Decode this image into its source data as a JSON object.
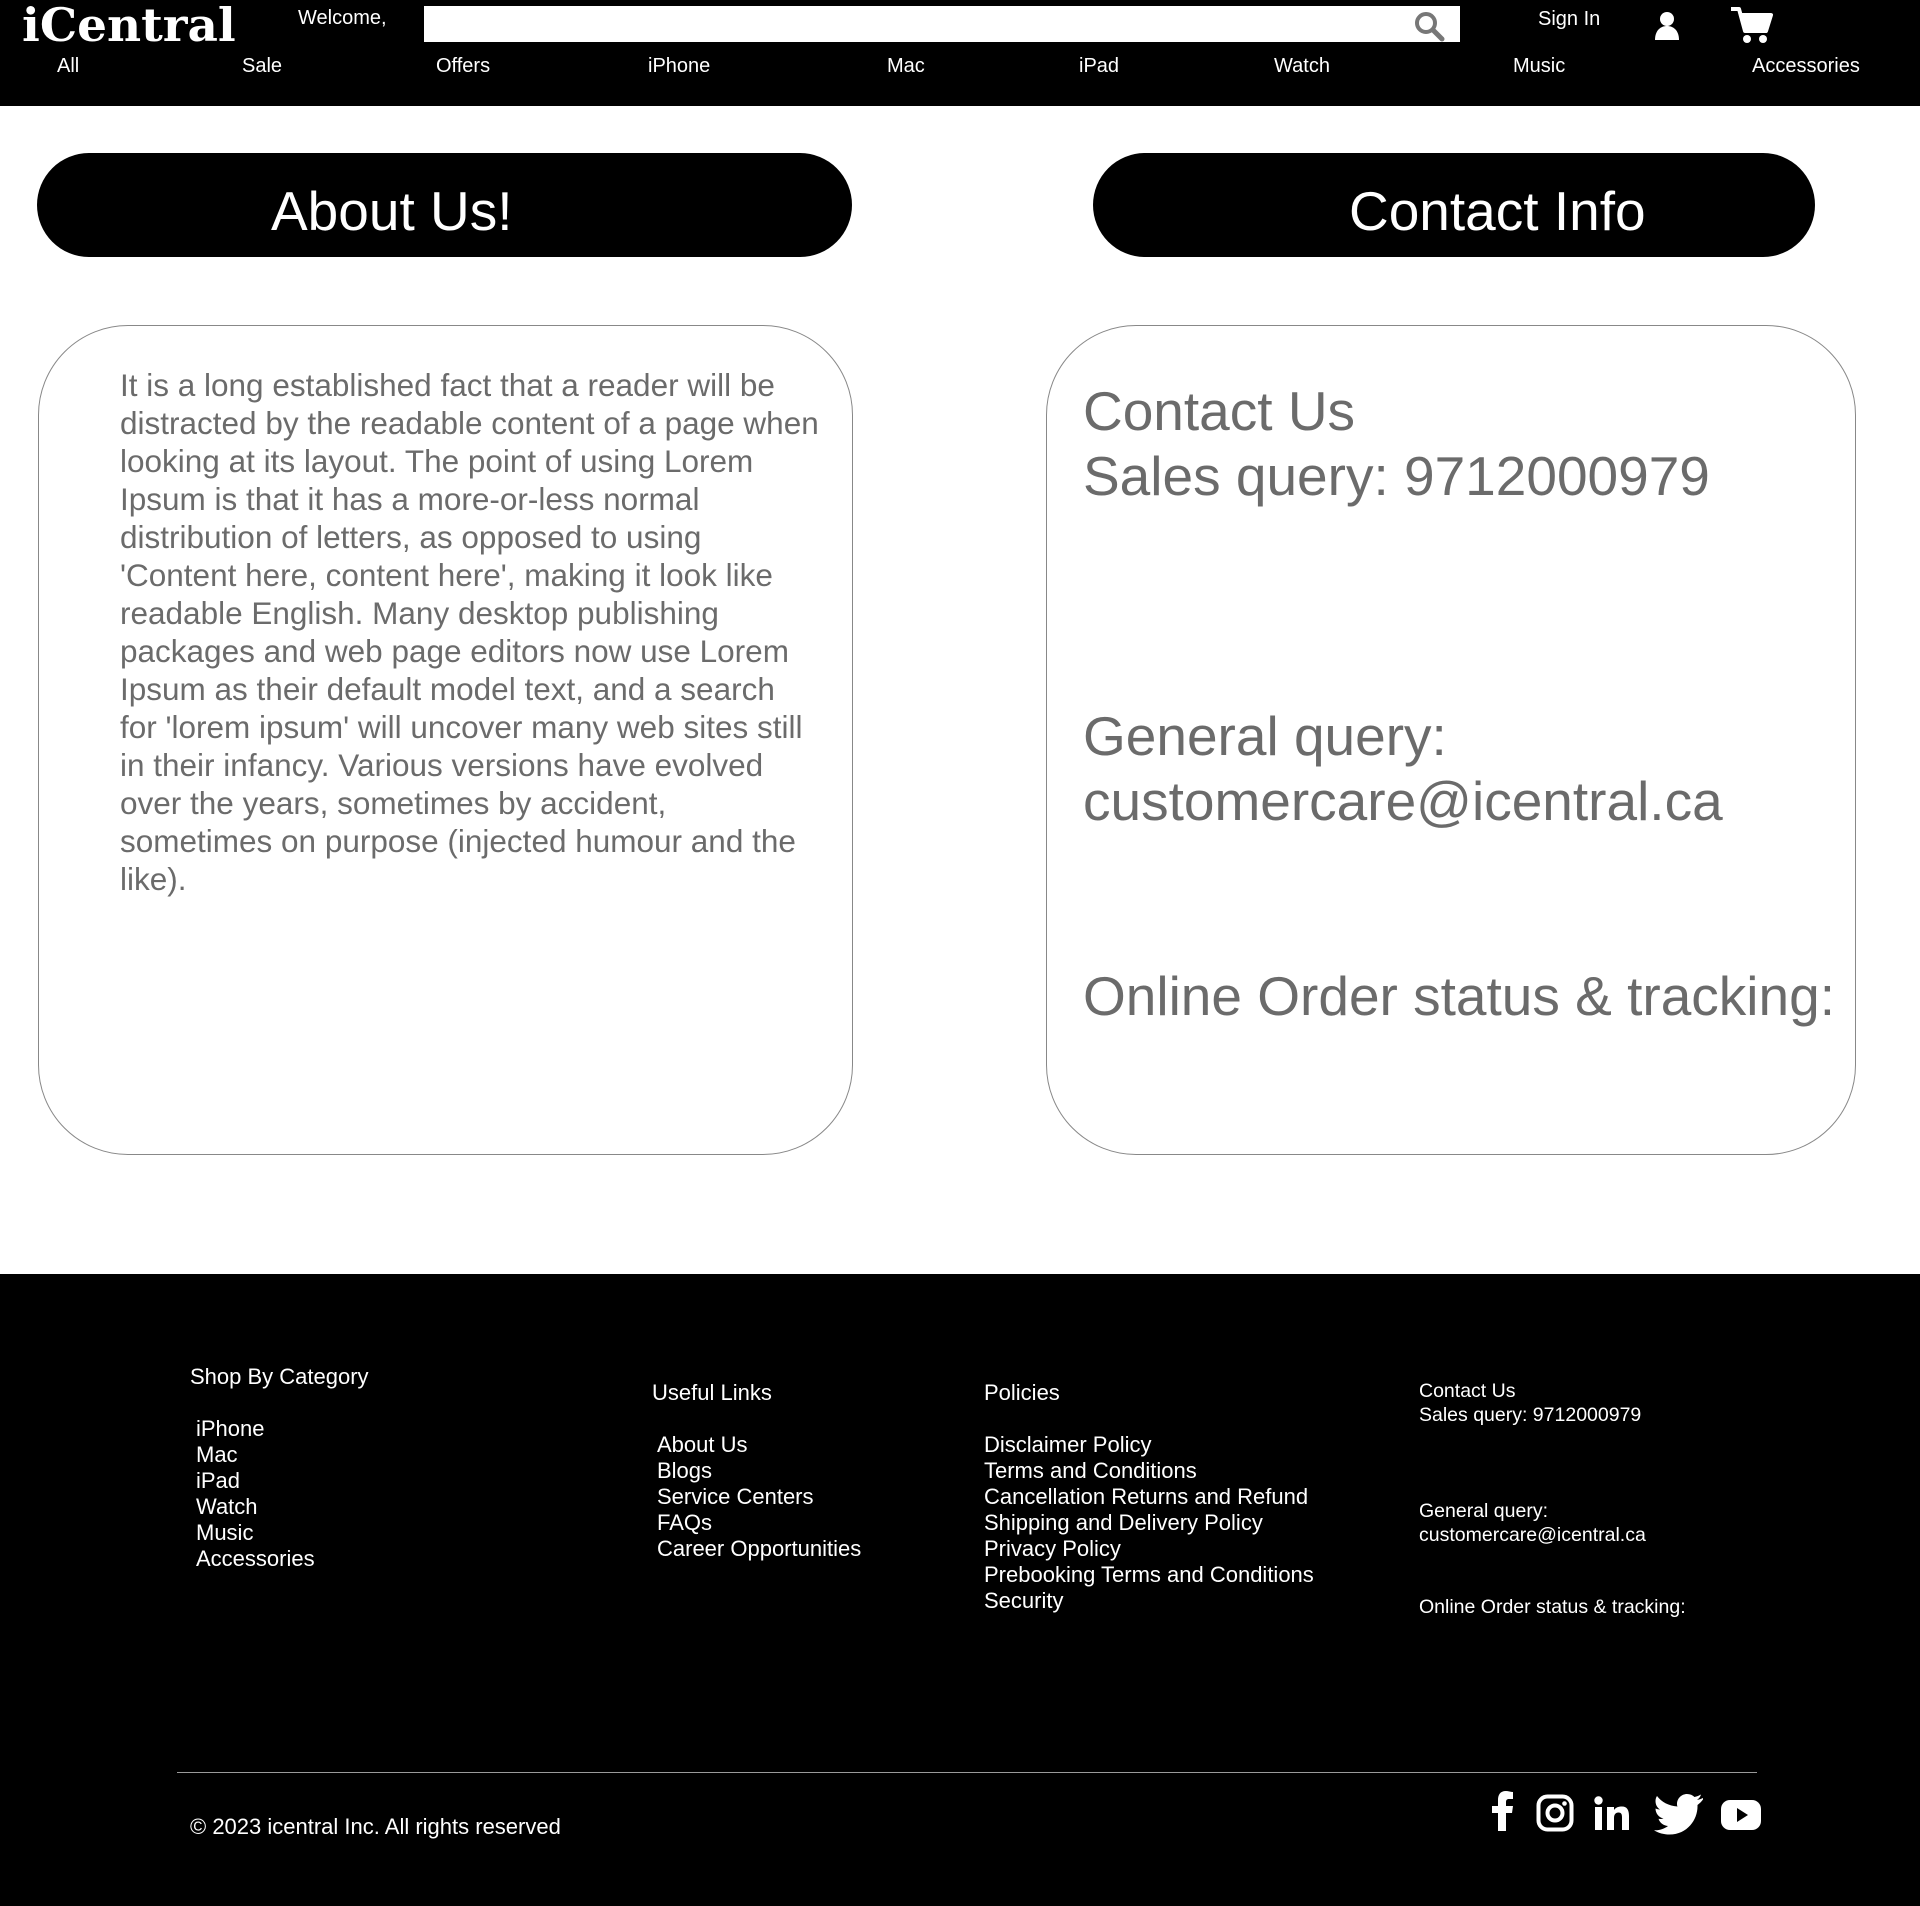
{
  "header": {
    "logo": "iCentral",
    "welcome": "Welcome,",
    "search_placeholder": "",
    "sign_in": "Sign In"
  },
  "nav": [
    "All",
    "Sale",
    "Offers",
    "iPhone",
    "Mac",
    "iPad",
    "Watch",
    "Music",
    "Accessories"
  ],
  "about": {
    "title": "About Us!",
    "text": "It is a long established fact that a reader will be distracted by the readable content of a page when looking at its layout. The point of using Lorem Ipsum is that it has a more-or-less normal distribution of letters, as opposed to using 'Content here, content here', making it look like readable English. Many desktop publishing packages and web page editors now use Lorem Ipsum as their default model text, and a search for 'lorem ipsum' will uncover many web sites still in their infancy. Various versions have evolved over the years, sometimes by accident, sometimes on purpose (injected humour and the like)."
  },
  "contact": {
    "title": "Contact Info",
    "heading": "Contact Us",
    "sales": "Sales query: 9712000979",
    "general_label": "General query:",
    "general_email": "customercare@icentral.ca",
    "order_status": "Online Order status & tracking:"
  },
  "footer": {
    "shop": {
      "title": "Shop By Category",
      "items": [
        "iPhone",
        "Mac",
        "iPad",
        "Watch",
        "Music",
        "Accessories"
      ]
    },
    "useful": {
      "title": "Useful Links",
      "items": [
        "About Us",
        "Blogs",
        "Service Centers",
        "FAQs",
        "Career Opportunities"
      ]
    },
    "policies": {
      "title": "Policies",
      "items": [
        "Disclaimer Policy",
        "Terms and Conditions",
        "Cancellation Returns and Refund",
        "Shipping and Delivery Policy",
        "Privacy Policy",
        "Prebooking Terms and Conditions",
        "Security"
      ]
    },
    "contact": {
      "heading": "Contact Us",
      "sales": "Sales query: 9712000979",
      "general_label": "General query:",
      "general_email": "customercare@icentral.ca",
      "order_status": "Online Order status & tracking:"
    },
    "copyright": "© 2023 icentral Inc. All rights reserved",
    "social_icons": [
      "facebook-icon",
      "instagram-icon",
      "linkedin-icon",
      "twitter-icon",
      "youtube-icon"
    ]
  },
  "colors": {
    "header_bg": "#000000",
    "footer_bg": "#000000",
    "body_text_gray": "#6b6b6b"
  }
}
